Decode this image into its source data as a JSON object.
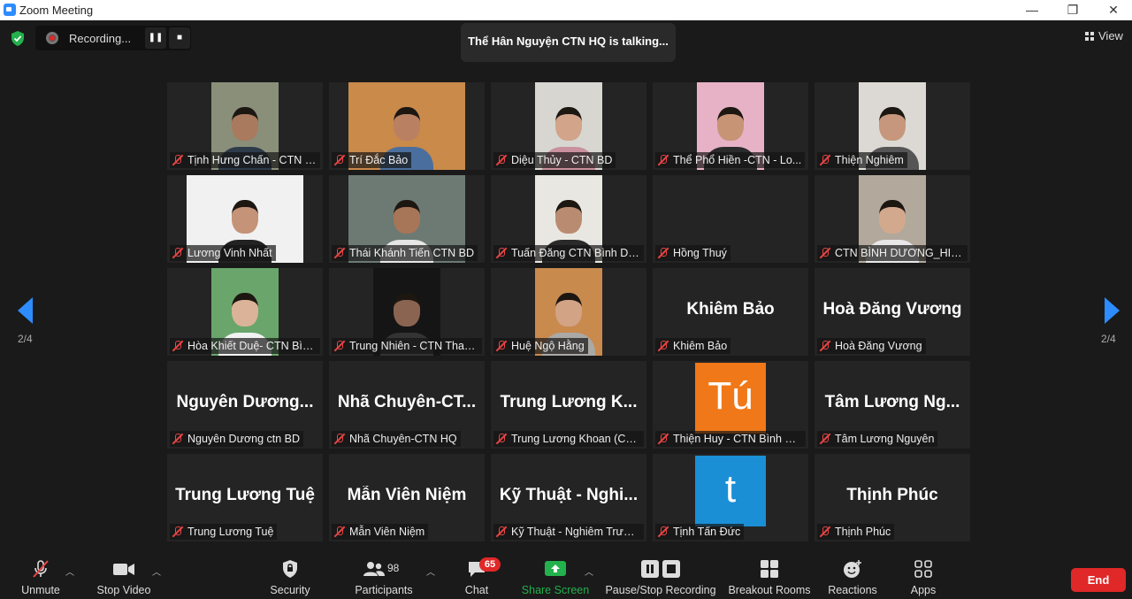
{
  "window": {
    "title": "Zoom Meeting",
    "minimize_glyph": "—",
    "restore_glyph": "❐",
    "close_glyph": "✕"
  },
  "recording": {
    "label": "Recording...",
    "pause_glyph": "❚❚",
    "stop_glyph": "■"
  },
  "talking_banner": "Thể Hân Nguyện CTN HQ is talking...",
  "view_label": "View",
  "pagination": {
    "left": "2/4",
    "right": "2/4"
  },
  "tiles": [
    {
      "name": "Tịnh Hưng Chấn - CTN Bì...",
      "video": true,
      "bg": "#8a8f7a",
      "vx": 50,
      "vw": 76,
      "skin": "#a97a5e",
      "shirt": "#2e3b4a"
    },
    {
      "name": "Trí Đắc Bảo",
      "video": true,
      "bg": "#c98a4a",
      "vx": 22,
      "vw": 132,
      "skin": "#b98062",
      "shirt": "#4a6f9e"
    },
    {
      "name": "Diệu Thủy - CTN BD",
      "video": true,
      "bg": "#d7d6d0",
      "vx": 50,
      "vw": 76,
      "skin": "#d2a58a",
      "shirt": "#c9909d"
    },
    {
      "name": "Thể Phổ Hiền  -CTN - Lo...",
      "video": true,
      "bg": "#e7b2c6",
      "vx": 50,
      "vw": 76,
      "skin": "#c79476",
      "shirt": "#2b2b2b"
    },
    {
      "name": "Thiện Nghiêm",
      "video": true,
      "bg": "#dcd9d4",
      "vx": 50,
      "vw": 76,
      "skin": "#c6977c",
      "shirt": "#555"
    },
    {
      "name": "Lương Vinh Nhất",
      "video": true,
      "bg": "#f1f1f1",
      "vx": 22,
      "vw": 132,
      "skin": "#c49378",
      "shirt": "#222"
    },
    {
      "name": "Thái Khánh Tiến CTN BD",
      "video": true,
      "bg": "#6c7a73",
      "vx": 22,
      "vw": 132,
      "skin": "#a77558",
      "shirt": "#e6e6e6"
    },
    {
      "name": "Tuấn Đăng CTN Bình Dư...",
      "video": true,
      "bg": "#e9e7e1",
      "vx": 50,
      "vw": 76,
      "skin": "#b98c72",
      "shirt": "#2a2a2a"
    },
    {
      "name": "Hồng Thuý",
      "video": false,
      "big": ""
    },
    {
      "name": "CTN BÌNH DƯƠNG_HIỀN ...",
      "video": true,
      "bg": "#b2a89c",
      "vx": 50,
      "vw": 76,
      "skin": "#d3a98d",
      "shirt": "#e8e8e8"
    },
    {
      "name": "Hòa Khiết Duệ- CTN Bình...",
      "video": true,
      "bg": "#6aa56b",
      "vx": 50,
      "vw": 76,
      "skin": "#dbb398",
      "shirt": "#f2f2f2"
    },
    {
      "name": "Trung Nhiên - CTN Than...",
      "video": true,
      "bg": "#151515",
      "vx": 50,
      "vw": 76,
      "skin": "#8a6450",
      "shirt": "#333"
    },
    {
      "name": "Huệ Ngộ Hằng",
      "video": true,
      "bg": "#c98a4e",
      "vx": 50,
      "vw": 76,
      "skin": "#d2a385",
      "shirt": "#aaa9a6"
    },
    {
      "name": "Khiêm Bảo",
      "video": false,
      "big": "Khiêm Bảo"
    },
    {
      "name": "Hoà Đăng Vương",
      "video": false,
      "big": "Hoà Đăng Vương"
    },
    {
      "name": "Nguyên Dương ctn BD",
      "video": false,
      "big": "Nguyên  Dương..."
    },
    {
      "name": "Nhã Chuyên-CTN HQ",
      "video": false,
      "big": "Nhã  Chuyên-CT..."
    },
    {
      "name": "Trung Lương Khoan (CTN...",
      "video": false,
      "big": "Trung  Lương  K..."
    },
    {
      "name": "Thiện Huy - CTN Bình Dư...",
      "video": false,
      "avatar": "Tú",
      "avatar_color": "#f07818"
    },
    {
      "name": "Tâm Lương Nguyên",
      "video": false,
      "big": "Tâm  Lương  Ng..."
    },
    {
      "name": "Trung Lương Tuệ",
      "video": false,
      "big": "Trung Lương Tuệ"
    },
    {
      "name": "Mẫn Viên Niệm",
      "video": false,
      "big": "Mẫn Viên Niệm"
    },
    {
      "name": "Kỹ Thuật - Nghiêm Trường",
      "video": false,
      "big": "Kỹ  Thuật  - Nghi..."
    },
    {
      "name": "Tịnh Tấn Đức",
      "video": false,
      "avatar": "t",
      "avatar_color": "#1b8fd6"
    },
    {
      "name": "Thịnh Phúc",
      "video": false,
      "big": "Thịnh Phúc"
    }
  ],
  "toolbar": {
    "unmute": "Unmute",
    "stop_video": "Stop Video",
    "security": "Security",
    "participants": "Participants",
    "participants_count": "98",
    "chat": "Chat",
    "chat_badge": "65",
    "share_screen": "Share Screen",
    "pause_stop_recording": "Pause/Stop Recording",
    "breakout_rooms": "Breakout Rooms",
    "reactions": "Reactions",
    "apps": "Apps",
    "end": "End"
  },
  "colors": {
    "accent": "#2d8cff",
    "share_green": "#22b14c",
    "end_red": "#e02828"
  }
}
